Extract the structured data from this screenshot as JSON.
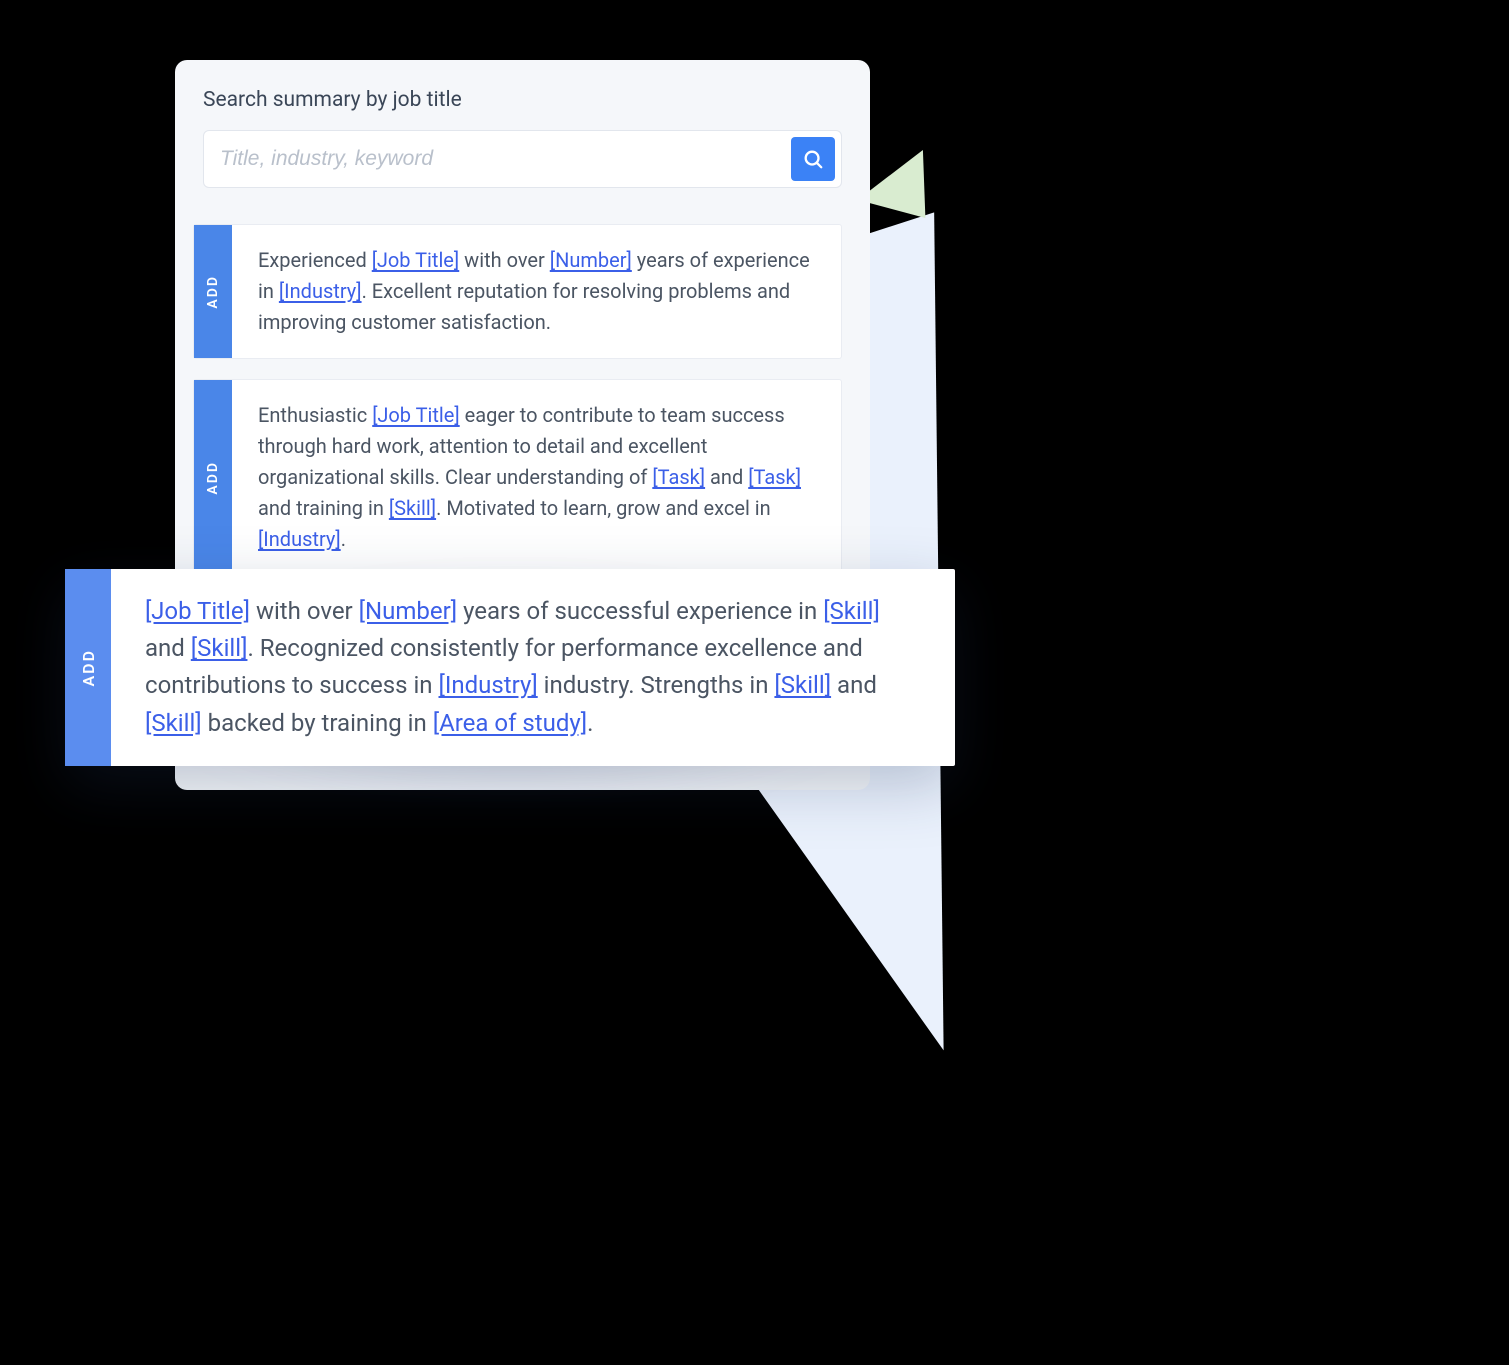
{
  "panel": {
    "title": "Search summary by job title",
    "search": {
      "placeholder": "Title, industry, keyword",
      "value": ""
    }
  },
  "add_label": "ADD",
  "cards": [
    {
      "segments": [
        {
          "t": "Experienced "
        },
        {
          "t": "[Job Title]",
          "ph": true
        },
        {
          "t": " with over "
        },
        {
          "t": "[Number]",
          "ph": true
        },
        {
          "t": " years of experience in "
        },
        {
          "t": "[Industry]",
          "ph": true
        },
        {
          "t": ". Excellent reputation for resolving problems and improving customer satisfaction."
        }
      ]
    },
    {
      "segments": [
        {
          "t": "Enthusiastic "
        },
        {
          "t": "[Job Title]",
          "ph": true
        },
        {
          "t": " eager to contribute to team success through hard work, attention to detail and excellent organizational skills. Clear understanding of "
        },
        {
          "t": "[Task]",
          "ph": true
        },
        {
          "t": " and "
        },
        {
          "t": "[Task]",
          "ph": true
        },
        {
          "t": " and training in "
        },
        {
          "t": "[Skill]",
          "ph": true
        },
        {
          "t": ". Motivated to learn, grow and excel in "
        },
        {
          "t": "[Industry]",
          "ph": true
        },
        {
          "t": "."
        }
      ]
    }
  ],
  "popout": {
    "segments": [
      {
        "t": "[Job Title]",
        "ph": true
      },
      {
        "t": " with over "
      },
      {
        "t": "[Number]",
        "ph": true
      },
      {
        "t": " years of successful experience in "
      },
      {
        "t": "[Skill]",
        "ph": true
      },
      {
        "t": " and "
      },
      {
        "t": "[Skill]",
        "ph": true
      },
      {
        "t": ". Recognized consistently for performance excellence and contributions to success in "
      },
      {
        "t": "[Industry]",
        "ph": true
      },
      {
        "t": " industry. Strengths in "
      },
      {
        "t": "[Skill]",
        "ph": true
      },
      {
        "t": " and "
      },
      {
        "t": "[Skill]",
        "ph": true
      },
      {
        "t": " backed by training in "
      },
      {
        "t": "[Area of study]",
        "ph": true
      },
      {
        "t": "."
      }
    ]
  }
}
